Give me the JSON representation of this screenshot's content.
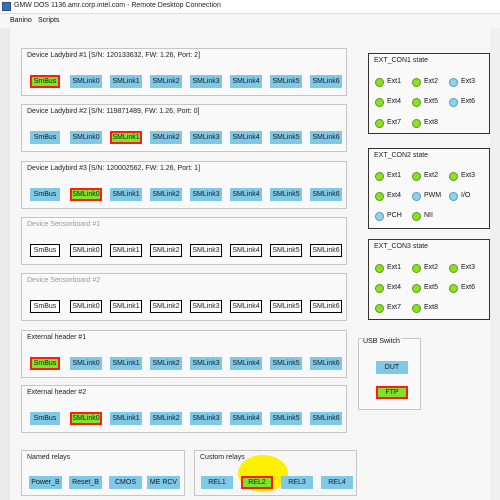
{
  "window": {
    "title": "GMW DOS 1136.amr.corp.intel.com - Remote Desktop Connection"
  },
  "menu": {
    "items": [
      "Banino",
      "Scripts"
    ]
  },
  "ladybird_buttons": [
    "SmBus",
    "SMLink0",
    "SMLink1",
    "SMLink2",
    "SMLink3",
    "SMLink4",
    "SMLink5",
    "SMLink6"
  ],
  "groups": [
    {
      "title": "Device Ladybird #1 [S/N: 120133632, FW: 1.26, Port: 2]",
      "active_index": 0,
      "disabled": false
    },
    {
      "title": "Device Ladybird #2 [S/N: 119871489, FW: 1.26, Port: 0]",
      "active_index": 2,
      "disabled": false
    },
    {
      "title": "Device Ladybird #3 [S/N: 120002562, FW: 1.26, Port: 1]",
      "active_index": 1,
      "disabled": false
    },
    {
      "title": "Device Sensorboard #1",
      "active_index": -1,
      "disabled": true
    },
    {
      "title": "Device Sensorboard #2",
      "active_index": -1,
      "disabled": true
    },
    {
      "title": "External header #1",
      "active_index": 0,
      "disabled": false
    },
    {
      "title": "External header #2",
      "active_index": 1,
      "disabled": false
    }
  ],
  "named_relays": {
    "title": "Named relays",
    "buttons": [
      "Power_B",
      "Reset_B",
      "CMOS",
      "ME RCV"
    ]
  },
  "custom_relays": {
    "title": "Custom relays",
    "buttons": [
      "REL1",
      "REL2",
      "REL3",
      "REL4"
    ],
    "active_index": 1
  },
  "ext_con1": {
    "title": "EXT_CON1 state",
    "items": [
      {
        "label": "Ext1",
        "color": "green"
      },
      {
        "label": "Ext2",
        "color": "green"
      },
      {
        "label": "Ext3",
        "color": "blue"
      },
      {
        "label": "Ext4",
        "color": "green"
      },
      {
        "label": "Ext5",
        "color": "green"
      },
      {
        "label": "Ext6",
        "color": "blue"
      },
      {
        "label": "Ext7",
        "color": "green"
      },
      {
        "label": "Ext8",
        "color": "green"
      }
    ]
  },
  "ext_con2": {
    "title": "EXT_CON2 state",
    "items": [
      {
        "label": "Ext1",
        "color": "green"
      },
      {
        "label": "Ext2",
        "color": "green"
      },
      {
        "label": "Ext3",
        "color": "green"
      },
      {
        "label": "Ext4",
        "color": "green"
      },
      {
        "label": "PWM",
        "color": "blue"
      },
      {
        "label": "I/O",
        "color": "blue"
      },
      {
        "label": "PCH",
        "color": "blue"
      },
      {
        "label": "NII",
        "color": "green"
      }
    ]
  },
  "ext_con3": {
    "title": "EXT_CON3 state",
    "items": [
      {
        "label": "Ext1",
        "color": "green"
      },
      {
        "label": "Ext2",
        "color": "green"
      },
      {
        "label": "Ext3",
        "color": "green"
      },
      {
        "label": "Ext4",
        "color": "green"
      },
      {
        "label": "Ext5",
        "color": "green"
      },
      {
        "label": "Ext6",
        "color": "green"
      },
      {
        "label": "Ext7",
        "color": "green"
      },
      {
        "label": "Ext8",
        "color": "green"
      }
    ]
  },
  "usb_switch": {
    "title": "USB Switch",
    "buttons": [
      "DUT",
      "FTP"
    ],
    "active_index": 1
  },
  "colors": {
    "button_blue": "#7fc8e6",
    "active_green": "#7ee32a",
    "active_border": "#ff1a1a",
    "led_green": "#8ce024",
    "led_blue": "#8fd2ec",
    "highlight": "#ffef00"
  }
}
